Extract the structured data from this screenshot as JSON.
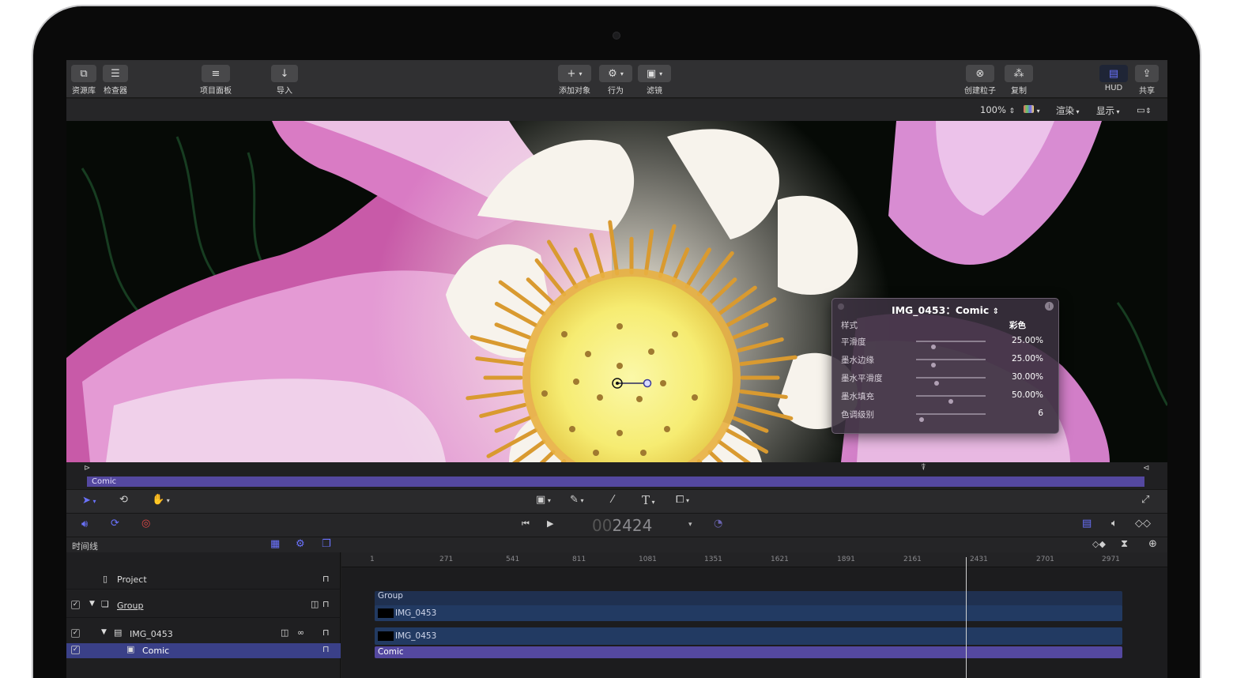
{
  "toolbar": {
    "library": "资源库",
    "inspector": "检查器",
    "project_pane": "项目面板",
    "import": "导入",
    "add_object": "添加对象",
    "behaviors": "行为",
    "filters": "滤镜",
    "make_particles": "创建粒子",
    "replicate": "复制",
    "hud": "HUD",
    "share": "共享"
  },
  "viewer_bar": {
    "zoom": "100%",
    "render": "渲染",
    "view": "显示"
  },
  "hud": {
    "title": "IMG_0453：Comic",
    "rows": [
      {
        "label": "样式",
        "value": "彩色"
      },
      {
        "label": "平滑度",
        "value": "25.00%",
        "level": 0.25
      },
      {
        "label": "墨水边缘",
        "value": "25.00%",
        "level": 0.25
      },
      {
        "label": "墨水平滑度",
        "value": "30.00%",
        "level": 0.3
      },
      {
        "label": "墨水填充",
        "value": "50.00%",
        "level": 0.5
      },
      {
        "label": "色调级别",
        "value": "6",
        "level": 0.08
      }
    ]
  },
  "mini_timeline": {
    "bar_label": "Comic"
  },
  "transport": {
    "timecode_dim": "00",
    "timecode": "2424"
  },
  "timeline": {
    "label": "时间线",
    "ruler": [
      "1",
      "271",
      "541",
      "811",
      "1081",
      "1351",
      "1621",
      "1891",
      "2161",
      "2431",
      "2701",
      "2971"
    ],
    "layers": [
      {
        "name": "Project"
      },
      {
        "name": "Group"
      },
      {
        "name": "IMG_0453"
      },
      {
        "name": "Comic"
      }
    ],
    "tracks": {
      "group": "Group",
      "img1": "IMG_0453",
      "img2": "IMG_0453",
      "comic": "Comic"
    }
  },
  "colors": {
    "accent": "#6b73ff",
    "filter_bar": "#5448a0",
    "track": "#223656",
    "selection": "#3a4088"
  }
}
